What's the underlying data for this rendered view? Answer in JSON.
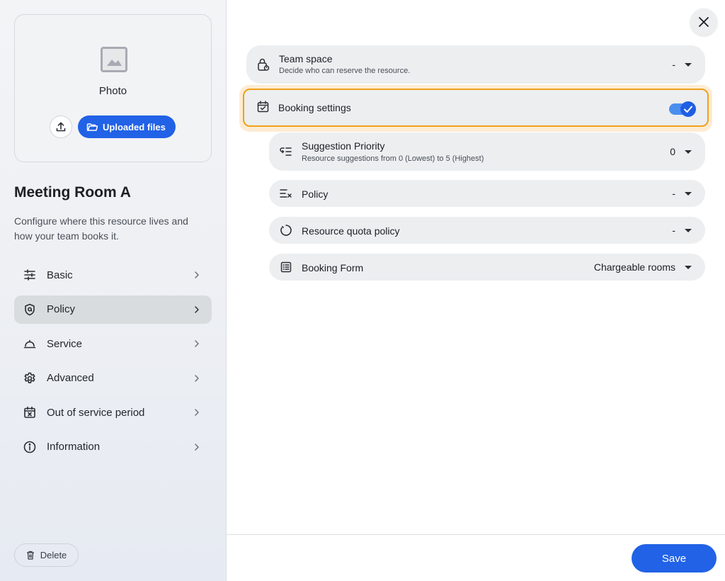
{
  "sidebar": {
    "photo": {
      "label": "Photo",
      "upload_icon": "upload-icon",
      "uploaded_files_label": "Uploaded files"
    },
    "resource_name": "Meeting Room A",
    "description": "Configure where this resource lives and how your team books it.",
    "nav": [
      {
        "label": "Basic",
        "icon": "sliders-icon",
        "active": false
      },
      {
        "label": "Policy",
        "icon": "shield-icon",
        "active": true
      },
      {
        "label": "Service",
        "icon": "service-bell-icon",
        "active": false
      },
      {
        "label": "Advanced",
        "icon": "gear-icon",
        "active": false
      },
      {
        "label": "Out of service period",
        "icon": "calendar-x-icon",
        "active": false
      },
      {
        "label": "Information",
        "icon": "info-icon",
        "active": false
      }
    ],
    "delete_label": "Delete"
  },
  "main": {
    "team_space": {
      "title": "Team space",
      "subtitle": "Decide who can reserve the resource.",
      "value": "-"
    },
    "booking_settings": {
      "title": "Booking settings",
      "enabled": true
    },
    "suggestion_priority": {
      "title": "Suggestion Priority",
      "subtitle": "Resource suggestions from 0 (Lowest) to 5 (Highest)",
      "value": "0"
    },
    "policy": {
      "title": "Policy",
      "value": "-"
    },
    "resource_quota_policy": {
      "title": "Resource quota policy",
      "value": "-"
    },
    "booking_form": {
      "title": "Booking Form",
      "value": "Chargeable rooms"
    },
    "save_label": "Save"
  },
  "colors": {
    "accent": "#2162e6",
    "highlight": "#f0a11a",
    "toggle": "#1f5ee4"
  }
}
